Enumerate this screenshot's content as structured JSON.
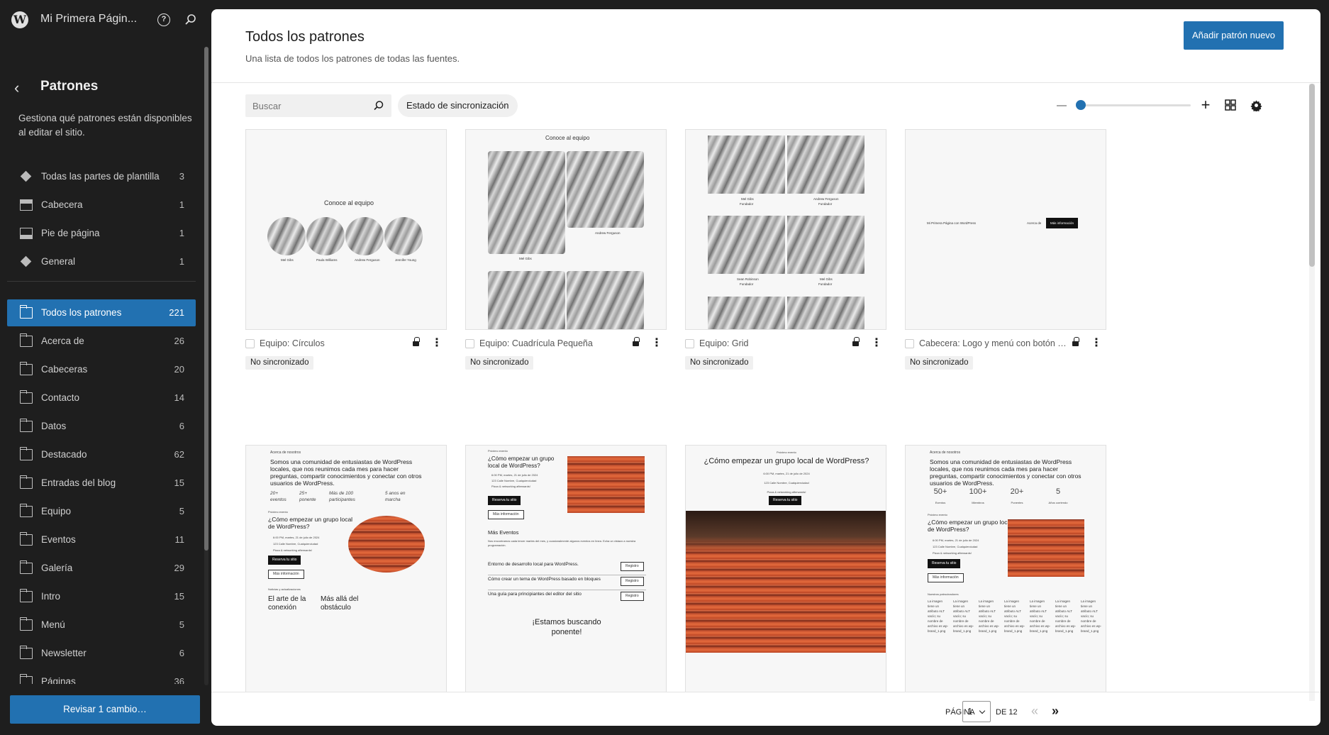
{
  "app": {
    "site_title": "Mi Primera Págin..."
  },
  "sidebar": {
    "title": "Patrones",
    "description": "Gestiona qué patrones están disponibles al editar el sitio.",
    "template_parts": [
      {
        "label": "Todas las partes de plantilla",
        "count": "3",
        "icon": "diamond-icon"
      },
      {
        "label": "Cabecera",
        "count": "1",
        "icon": "header-icon"
      },
      {
        "label": "Pie de página",
        "count": "1",
        "icon": "footer-icon"
      },
      {
        "label": "General",
        "count": "1",
        "icon": "diamond-icon"
      }
    ],
    "categories": [
      {
        "label": "Todos los patrones",
        "count": "221",
        "active": true
      },
      {
        "label": "Acerca de",
        "count": "26"
      },
      {
        "label": "Cabeceras",
        "count": "20"
      },
      {
        "label": "Contacto",
        "count": "14"
      },
      {
        "label": "Datos",
        "count": "6"
      },
      {
        "label": "Destacado",
        "count": "62"
      },
      {
        "label": "Entradas del blog",
        "count": "15"
      },
      {
        "label": "Equipo",
        "count": "5"
      },
      {
        "label": "Eventos",
        "count": "11"
      },
      {
        "label": "Galería",
        "count": "29"
      },
      {
        "label": "Intro",
        "count": "15"
      },
      {
        "label": "Menú",
        "count": "5"
      },
      {
        "label": "Newsletter",
        "count": "6"
      },
      {
        "label": "Páginas",
        "count": "36"
      }
    ],
    "review_button": "Revisar 1 cambio…"
  },
  "main": {
    "title": "Todos los patrones",
    "description": "Una lista de todos los patrones de todas las fuentes.",
    "add_button": "Añadir patrón nuevo",
    "search_placeholder": "Buscar",
    "sync_filter": "Estado de sincronización",
    "zoom_level": 0.0
  },
  "cards": [
    {
      "name": "Equipo: Círculos",
      "badge": "No sincronizado"
    },
    {
      "name": "Equipo: Cuadrícula Pequeña",
      "badge": "No sincronizado"
    },
    {
      "name": "Equipo: Grid",
      "badge": "No sincronizado"
    },
    {
      "name": "Cabecera: Logo y menú con botón de ac…",
      "badge": "No sincronizado"
    }
  ],
  "previews": {
    "team_title": "Conoce al equipo",
    "team_circles_names": [
      "Mel Gibs",
      "Paula Williams",
      "Andrew Ferguson",
      "Jennifer Young"
    ],
    "grid_small_names": [
      "Mel Gibs",
      "Andrew Ferguson"
    ],
    "grid_names": [
      [
        "Mel Gibs",
        "Fundador"
      ],
      [
        "Andrew Ferguson",
        "Fundador"
      ],
      [
        "Sean Robinson",
        "Fundador"
      ],
      [
        "Mel Gibs",
        "Fundador"
      ]
    ],
    "header_site": "Mi Primera Página con WordPress",
    "header_link": "Acerca de",
    "header_button": "Más información",
    "about_label": "Acerca de nosotros",
    "about_text": "Somos una comunidad de entusiastas de WordPress locales, que nos reunimos cada mes para hacer preguntas, compartir conocimientos y conectar con otros usuarios de WordPress.",
    "stats": [
      [
        "20+",
        "eventos"
      ],
      [
        "25+",
        "ponente"
      ],
      [
        "Más de 100",
        "participantes"
      ],
      [
        "5 anos en",
        "marcha"
      ]
    ],
    "event_label": "Próximo evento",
    "event_title": "¿Cómo empezar un grupo local de WordPress?",
    "event_items": [
      "6:00 PM, martes, 21 de julio de 2024",
      "123 Calle Nombre, Cualquierciudad",
      "Pizza & networking afterwards!"
    ],
    "reserve": "Reserva tu sitio",
    "more_info": "Más información",
    "news_label": "Noticias y actualizaciones",
    "news1": "El arte de la conexión",
    "news2": "Más allá del obstáculo",
    "more_events": "Más Eventos",
    "more_events_desc": "Nos encontramos cada tercer martes del mes, y ocasionalmente algunos eventos en línea. Echa un vistazo a nuestra programación.",
    "event_list": [
      "Entorno de desarrollo local para WordPress.",
      "Cómo crear un tema de WordPress basado en bloques",
      "Una guía para principiantes del editor del sitio"
    ],
    "register": "Registro",
    "speaker_cta": "¡Estamos buscando ponente!",
    "stats2": [
      [
        "50+",
        "Eventos"
      ],
      [
        "100+",
        "Miembros"
      ],
      [
        "20+",
        "Ponentes"
      ],
      [
        "5",
        "Años corriendo"
      ]
    ],
    "sponsors_label": "Nuestros patrocinadores",
    "sponsor_alt": "La imagen tiene un atributo ALT vacío; su nombre de archivo es wp-brand_1.png"
  },
  "pagination": {
    "label": "PÁGINA",
    "current": "1",
    "of": "DE 12",
    "first_icon": "first-page-icon",
    "last_icon": "last-page-icon"
  }
}
